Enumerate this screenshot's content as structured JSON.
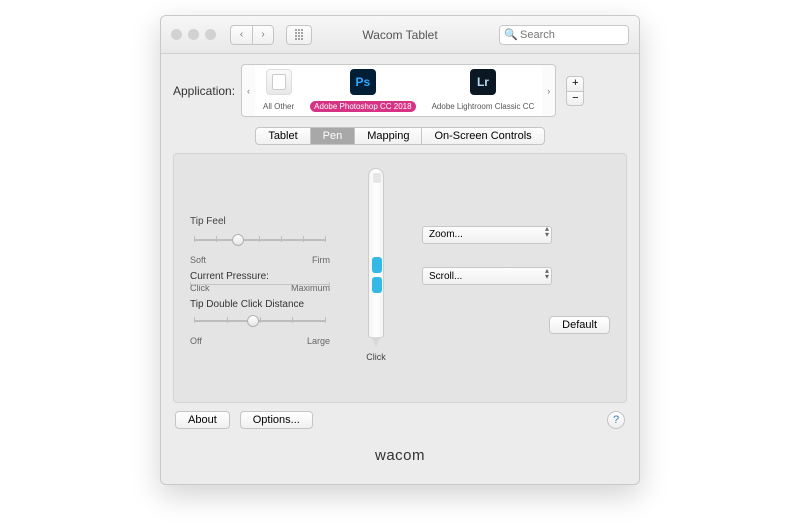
{
  "title": "Wacom Tablet",
  "search": {
    "placeholder": "Search"
  },
  "app_label": "Application:",
  "apps": [
    {
      "name": "All Other"
    },
    {
      "name": "Adobe Photoshop CC 2018",
      "selected": true
    },
    {
      "name": "Adobe Lightroom Classic CC"
    }
  ],
  "tabs": {
    "tablet": "Tablet",
    "pen": "Pen",
    "mapping": "Mapping",
    "osc": "On-Screen Controls"
  },
  "tip_feel": {
    "label": "Tip Feel",
    "soft": "Soft",
    "firm": "Firm"
  },
  "current_pressure": "Current Pressure:",
  "pressure_scale": {
    "min": "Click",
    "max": "Maximum"
  },
  "dbl": {
    "label": "Tip Double Click Distance",
    "off": "Off",
    "large": "Large"
  },
  "btn_upper": "Zoom...",
  "btn_lower": "Scroll...",
  "tip_action": "Click",
  "default_btn": "Default",
  "about": "About",
  "options": "Options...",
  "brand": "wacom"
}
